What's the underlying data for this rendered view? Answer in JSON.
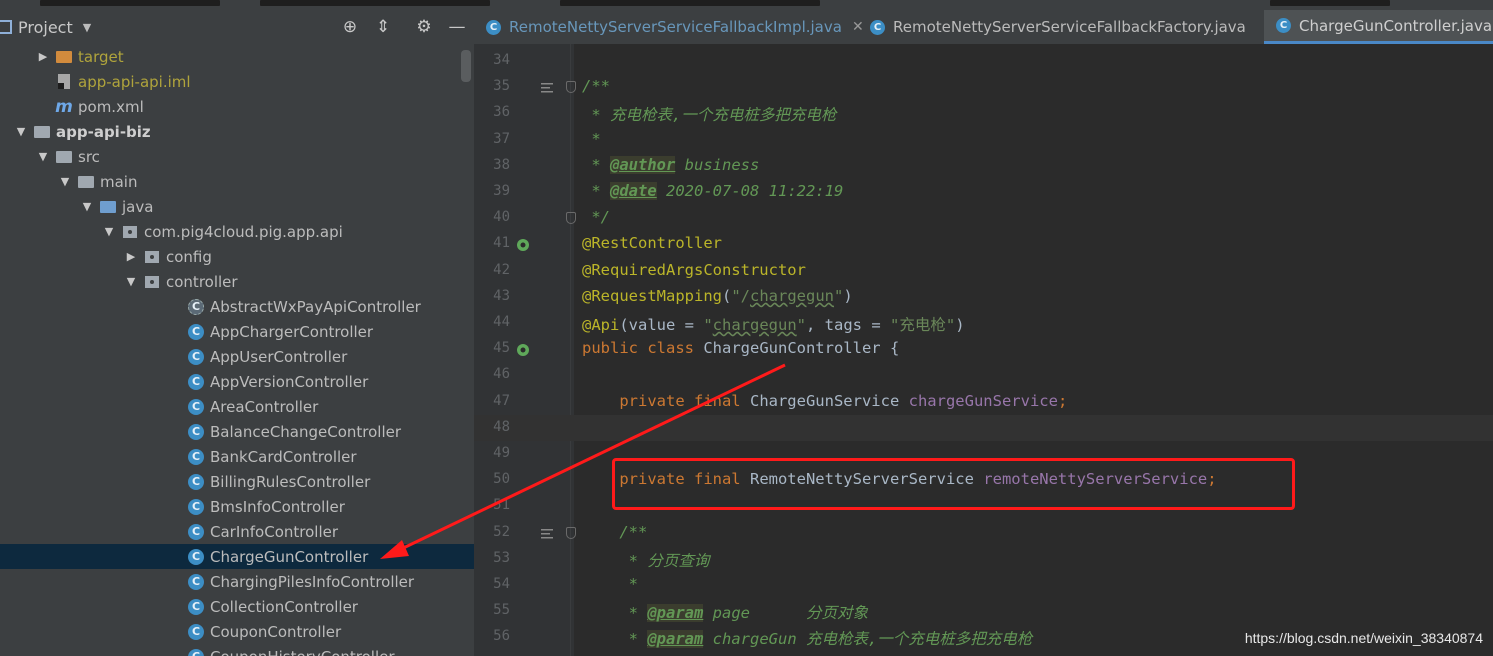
{
  "project_panel": {
    "title": "Project",
    "tree": [
      {
        "label": "target",
        "icon": "folder-orange-icon",
        "indent": 1,
        "expand": "collapsed",
        "style": "yellow"
      },
      {
        "label": "app-api-api.iml",
        "icon": "iml-file-icon",
        "indent": 1,
        "expand": "none",
        "style": "yellow"
      },
      {
        "label": "pom.xml",
        "icon": "maven-icon",
        "indent": 1,
        "expand": "none",
        "style": "normal"
      },
      {
        "label": "app-api-biz",
        "icon": "module-folder-icon",
        "indent": 0,
        "expand": "expanded",
        "style": "bold"
      },
      {
        "label": "src",
        "icon": "folder-icon",
        "indent": 1,
        "expand": "expanded",
        "style": "normal"
      },
      {
        "label": "main",
        "icon": "folder-icon",
        "indent": 2,
        "expand": "expanded",
        "style": "normal"
      },
      {
        "label": "java",
        "icon": "source-folder-icon",
        "indent": 3,
        "expand": "expanded",
        "style": "normal"
      },
      {
        "label": "com.pig4cloud.pig.app.api",
        "icon": "package-icon",
        "indent": 4,
        "expand": "expanded",
        "style": "normal"
      },
      {
        "label": "config",
        "icon": "package-icon",
        "indent": 5,
        "expand": "collapsed",
        "style": "normal"
      },
      {
        "label": "controller",
        "icon": "package-icon",
        "indent": 5,
        "expand": "expanded",
        "style": "normal"
      },
      {
        "label": "AbstractWxPayApiController",
        "icon": "abstract-class-icon",
        "indent": 7,
        "expand": "none",
        "style": "normal"
      },
      {
        "label": "AppChargerController",
        "icon": "class-icon",
        "indent": 7,
        "expand": "none",
        "style": "normal"
      },
      {
        "label": "AppUserController",
        "icon": "class-icon",
        "indent": 7,
        "expand": "none",
        "style": "normal"
      },
      {
        "label": "AppVersionController",
        "icon": "class-icon",
        "indent": 7,
        "expand": "none",
        "style": "normal"
      },
      {
        "label": "AreaController",
        "icon": "class-icon",
        "indent": 7,
        "expand": "none",
        "style": "normal"
      },
      {
        "label": "BalanceChangeController",
        "icon": "class-icon",
        "indent": 7,
        "expand": "none",
        "style": "normal"
      },
      {
        "label": "BankCardController",
        "icon": "class-icon",
        "indent": 7,
        "expand": "none",
        "style": "normal"
      },
      {
        "label": "BillingRulesController",
        "icon": "class-icon",
        "indent": 7,
        "expand": "none",
        "style": "normal"
      },
      {
        "label": "BmsInfoController",
        "icon": "class-icon",
        "indent": 7,
        "expand": "none",
        "style": "normal"
      },
      {
        "label": "CarInfoController",
        "icon": "class-icon",
        "indent": 7,
        "expand": "none",
        "style": "normal"
      },
      {
        "label": "ChargeGunController",
        "icon": "class-icon",
        "indent": 7,
        "expand": "none",
        "style": "normal",
        "selected": true
      },
      {
        "label": "ChargingPilesInfoController",
        "icon": "class-icon",
        "indent": 7,
        "expand": "none",
        "style": "normal"
      },
      {
        "label": "CollectionController",
        "icon": "class-icon",
        "indent": 7,
        "expand": "none",
        "style": "normal"
      },
      {
        "label": "CouponController",
        "icon": "class-icon",
        "indent": 7,
        "expand": "none",
        "style": "normal"
      },
      {
        "label": "CouponHistoryController",
        "icon": "class-icon",
        "indent": 7,
        "expand": "none",
        "style": "normal"
      }
    ]
  },
  "tabs": [
    {
      "label": "RemoteNettyServerServiceFallbackImpl.java",
      "active": false,
      "blue": true
    },
    {
      "label": "RemoteNettyServerServiceFallbackFactory.java",
      "active": false,
      "blue": false
    },
    {
      "label": "ChargeGunController.java",
      "active": true,
      "blue": false
    }
  ],
  "editor": {
    "lines": [
      {
        "n": "34",
        "html": ""
      },
      {
        "n": "35",
        "html": "<span class='cmt'>/**</span>",
        "gutter": "fold-lines",
        "fold": true
      },
      {
        "n": "36",
        "html": "<span class='cmt'> * 充电枪表,一个充电桩多把充电枪</span>"
      },
      {
        "n": "37",
        "html": "<span class='cmt'> *</span>"
      },
      {
        "n": "38",
        "html": "<span class='cmt'> * </span><span class='tag'>@author</span><span class='cmt'> business</span>"
      },
      {
        "n": "39",
        "html": "<span class='cmt'> * </span><span class='tag'>@date</span><span class='cmt'> 2020-07-08 11:22:19</span>"
      },
      {
        "n": "40",
        "html": "<span class='cmt'> */</span>",
        "fold": true
      },
      {
        "n": "41",
        "html": "<span class='ann'>@RestController</span>",
        "gutter": "bean"
      },
      {
        "n": "42",
        "html": "<span class='ann'>@RequiredArgsConstructor</span>"
      },
      {
        "n": "43",
        "html": "<span class='ann'>@RequestMapping</span>(<span class='str'>\"/<span class='under'>chargegun</span>\"</span>)"
      },
      {
        "n": "44",
        "html": "<span class='ann'>@Api</span>(value = <span class='str'>\"<span class='under'>chargegun</span>\"</span>, tags = <span class='str'>\"充电枪\"</span>)"
      },
      {
        "n": "45",
        "html": "<span class='kw'>public class </span>ChargeGunController {",
        "gutter": "bean2"
      },
      {
        "n": "46",
        "html": ""
      },
      {
        "n": "47",
        "html": "    <span class='kw'>private final </span>ChargeGunService <span class='fld'>chargeGunService</span><span class='kw'>;</span>"
      },
      {
        "n": "48",
        "html": "",
        "current": true
      },
      {
        "n": "49",
        "html": ""
      },
      {
        "n": "50",
        "html": "    <span class='kw'>private final </span>RemoteNettyServerService <span class='fld'>remoteNettyServerService</span><span class='kw'>;</span>"
      },
      {
        "n": "51",
        "html": ""
      },
      {
        "n": "52",
        "html": "    <span class='cmt'>/**</span>",
        "gutter": "fold-lines",
        "fold": true
      },
      {
        "n": "53",
        "html": "<span class='cmt'>     * 分页查询</span>"
      },
      {
        "n": "54",
        "html": "<span class='cmt'>     *</span>"
      },
      {
        "n": "55",
        "html": "<span class='cmt'>     * </span><span class='tag'>@param</span><span class='cmt'> page      分页对象</span>"
      },
      {
        "n": "56",
        "html": "<span class='cmt'>     * </span><span class='tag'>@param</span><span class='cmt'> chargeGun 充电枪表,一个充电桩多把充电枪</span>"
      }
    ]
  },
  "watermark": "https://blog.csdn.net/weixin_38340874",
  "colors": {
    "highlight_box": "#ff1a1a",
    "selection": "#0d293e",
    "accent": "#4a88c7"
  }
}
